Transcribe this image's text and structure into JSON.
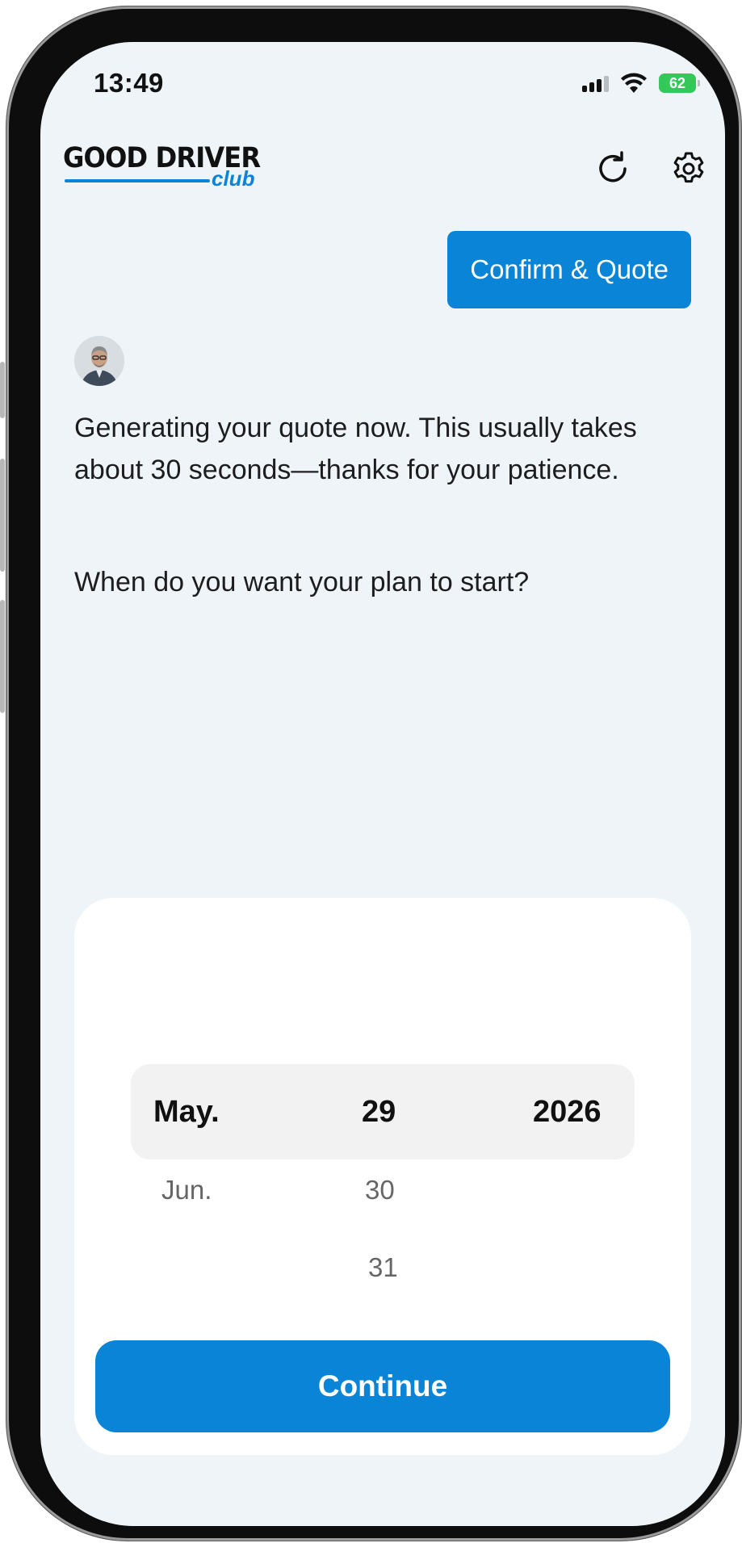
{
  "status_bar": {
    "time": "13:49",
    "battery": "62"
  },
  "header": {
    "logo_main": "GOOD DRIVER",
    "logo_sub": "club",
    "refresh_icon": "refresh-icon",
    "settings_icon": "gear-icon"
  },
  "chat": {
    "user_message": "Confirm & Quote",
    "bot_message": "Generating your quote now. This usually takes about 30 seconds—thanks for your patience.",
    "bot_question": "When do you want your plan to start?"
  },
  "date_picker": {
    "month": {
      "selected": "May.",
      "next": "Jun."
    },
    "day": {
      "selected": "29",
      "next": [
        "30",
        "31"
      ]
    },
    "year": {
      "selected": "2026"
    }
  },
  "continue_label": "Continue",
  "colors": {
    "accent": "#0a84d6",
    "screen_bg": "#eef4f7",
    "battery": "#34c759"
  }
}
